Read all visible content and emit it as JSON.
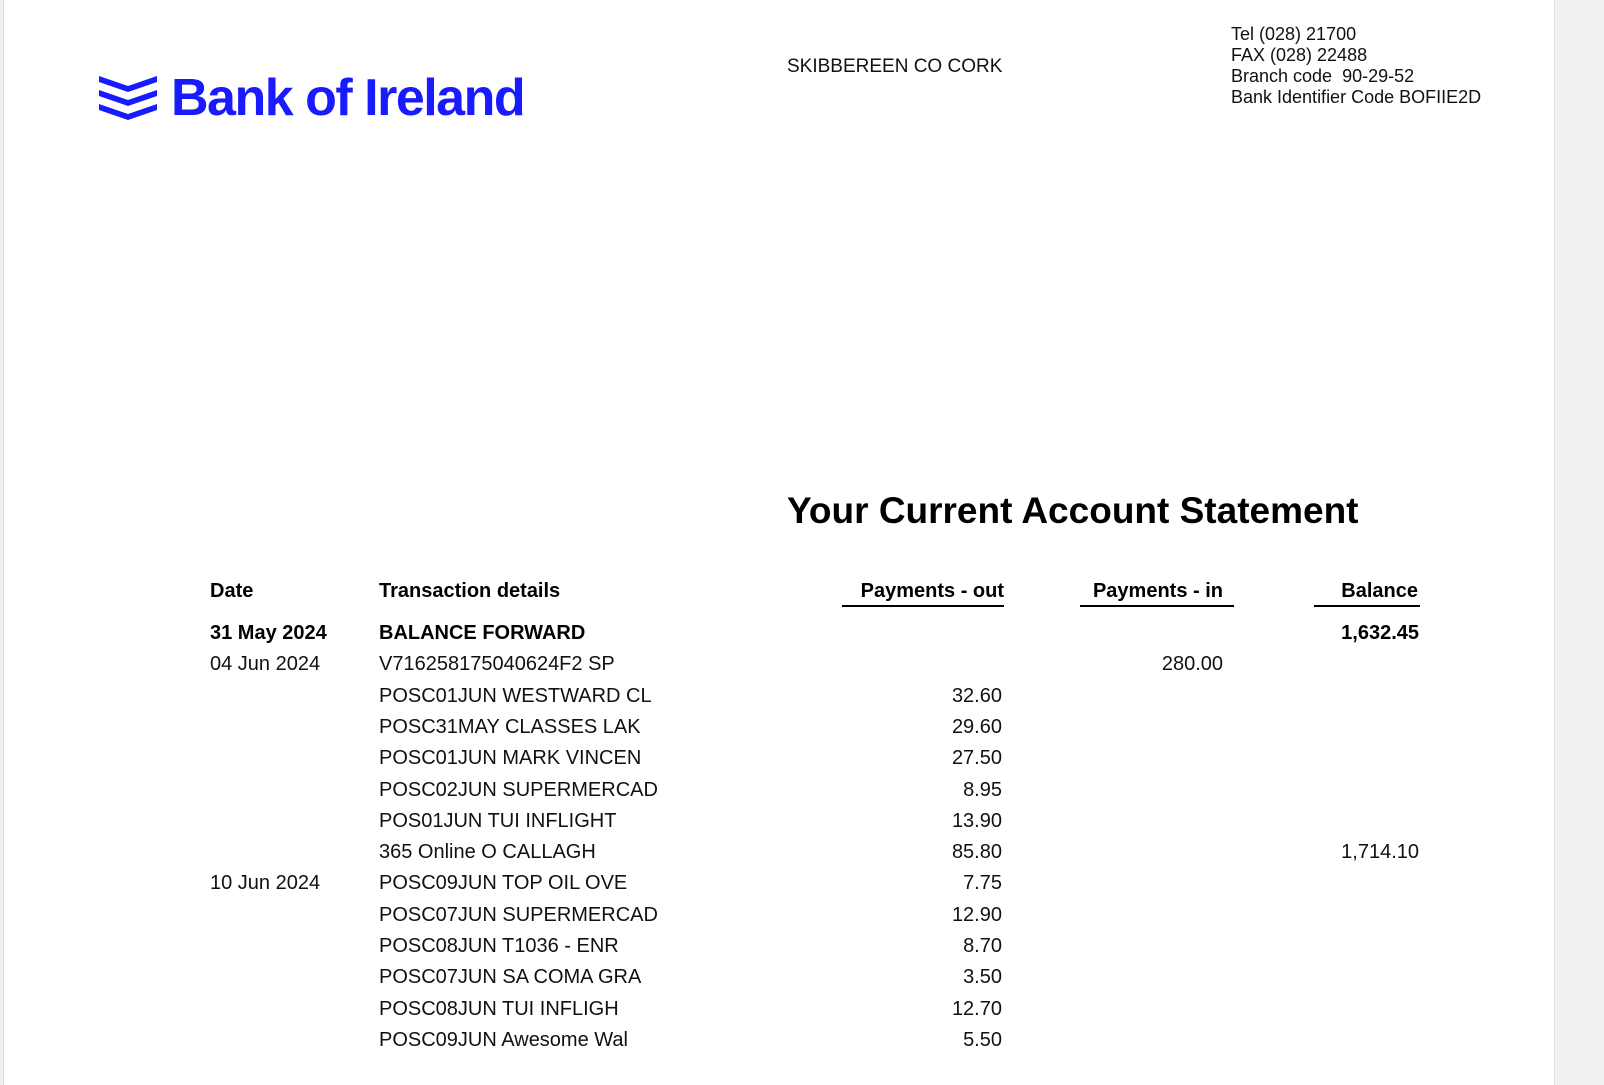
{
  "header": {
    "logo_text": "Bank of Ireland",
    "logo_icon": "bank-of-ireland-chevrons-icon",
    "brand_color": "#1a1aff",
    "branch_name": "SKIBBEREEN CO CORK",
    "contact": {
      "tel": "Tel (028) 21700",
      "fax": "FAX (028) 22488",
      "branch_code": "Branch code  90-29-52",
      "bic": "Bank Identifier Code BOFIIE2D"
    }
  },
  "statement": {
    "title": "Your Current Account Statement",
    "columns": {
      "date": "Date",
      "details": "Transaction details",
      "payments_out": "Payments - out",
      "payments_in": "Payments - in",
      "balance": "Balance"
    },
    "rows": [
      {
        "date": "31 May 2024",
        "details": "BALANCE FORWARD",
        "out": "",
        "in": "",
        "balance": "1,632.45"
      },
      {
        "date": "04 Jun 2024",
        "details": "V716258175040624F2 SP",
        "out": "",
        "in": "280.00",
        "balance": ""
      },
      {
        "date": "",
        "details": "POSC01JUN WESTWARD CL",
        "out": "32.60",
        "in": "",
        "balance": ""
      },
      {
        "date": "",
        "details": "POSC31MAY CLASSES LAK",
        "out": "29.60",
        "in": "",
        "balance": ""
      },
      {
        "date": "",
        "details": "POSC01JUN MARK VINCEN",
        "out": "27.50",
        "in": "",
        "balance": ""
      },
      {
        "date": "",
        "details": "POSC02JUN SUPERMERCAD",
        "out": "8.95",
        "in": "",
        "balance": ""
      },
      {
        "date": "",
        "details": "POS01JUN TUI INFLIGHT",
        "out": "13.90",
        "in": "",
        "balance": ""
      },
      {
        "date": "",
        "details": "365 Online  O CALLAGH",
        "out": "85.80",
        "in": "",
        "balance": "1,714.10"
      },
      {
        "date": "10 Jun 2024",
        "details": "POSC09JUN TOP OIL OVE",
        "out": "7.75",
        "in": "",
        "balance": ""
      },
      {
        "date": "",
        "details": "POSC07JUN SUPERMERCAD",
        "out": "12.90",
        "in": "",
        "balance": ""
      },
      {
        "date": "",
        "details": "POSC08JUN T1036 - ENR",
        "out": "8.70",
        "in": "",
        "balance": ""
      },
      {
        "date": "",
        "details": "POSC07JUN SA COMA GRA",
        "out": "3.50",
        "in": "",
        "balance": ""
      },
      {
        "date": "",
        "details": "POSC08JUN TUI INFLIGH",
        "out": "12.70",
        "in": "",
        "balance": ""
      },
      {
        "date": "",
        "details": "POSC09JUN Awesome Wal",
        "out": "5.50",
        "in": "",
        "balance": ""
      }
    ]
  }
}
